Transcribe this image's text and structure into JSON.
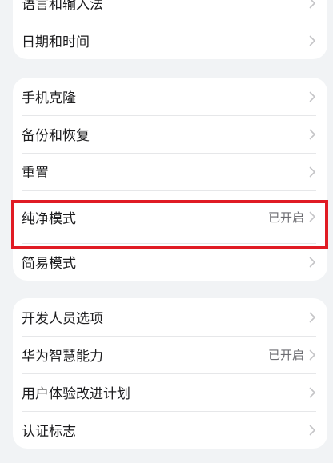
{
  "groups": [
    {
      "items": [
        {
          "label": "语言和输入法",
          "value": ""
        },
        {
          "label": "日期和时间",
          "value": ""
        }
      ]
    },
    {
      "items": [
        {
          "label": "手机克隆",
          "value": ""
        },
        {
          "label": "备份和恢复",
          "value": ""
        },
        {
          "label": "重置",
          "value": ""
        },
        {
          "label": "纯净模式",
          "value": "已开启"
        },
        {
          "label": "简易模式",
          "value": ""
        }
      ]
    },
    {
      "items": [
        {
          "label": "开发人员选项",
          "value": ""
        },
        {
          "label": "华为智慧能力",
          "value": "已开启"
        },
        {
          "label": "用户体验改进计划",
          "value": ""
        },
        {
          "label": "认证标志",
          "value": ""
        }
      ]
    }
  ],
  "colors": {
    "background": "#f1f3f5",
    "card": "#ffffff",
    "highlight_border": "#e01b24"
  },
  "icons": {
    "row_chevron": "chevron-right-icon"
  }
}
